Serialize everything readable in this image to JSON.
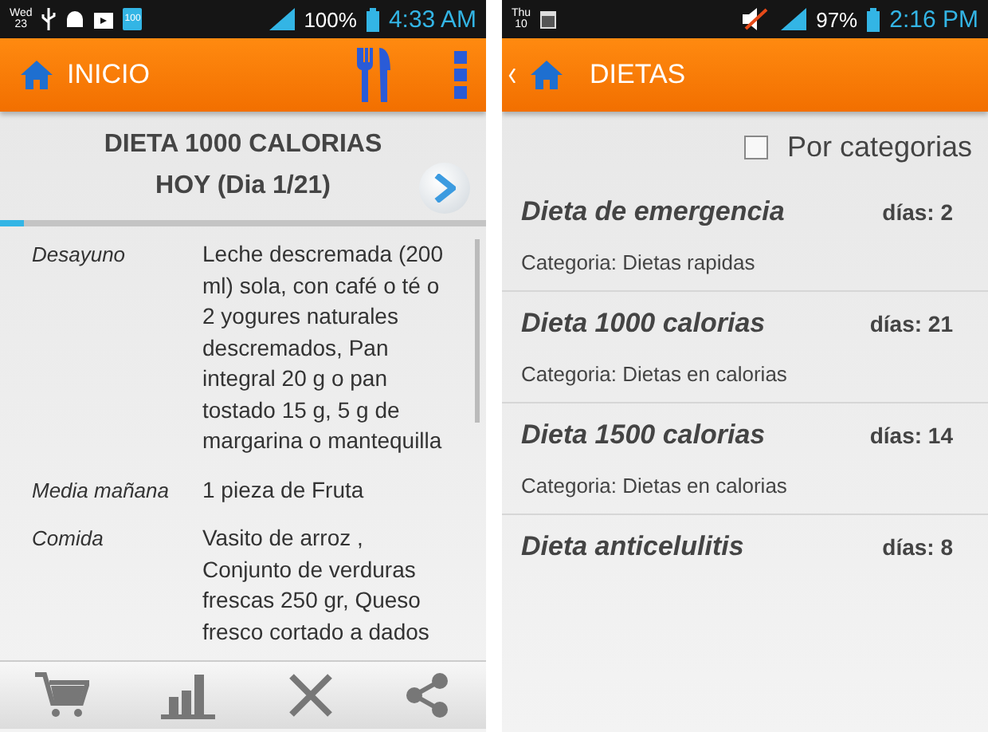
{
  "left_screen": {
    "status_bar": {
      "day_name": "Wed",
      "day_number": "23",
      "notification_badge": "100",
      "battery_percent": "100%",
      "time": "4:33 AM"
    },
    "action_bar": {
      "title": "INICIO"
    },
    "diet_title": "DIETA 1000 CALORIAS",
    "day_label": "HOY (Dia 1/21)",
    "progress": {
      "level": 0.05
    },
    "meals": [
      {
        "name": "Desayuno",
        "description": "Leche descremada (200 ml) sola, con café o té o 2 yogures naturales descremados, Pan integral 20 g o pan tostado 15 g, 5 g de margarina o mantequilla"
      },
      {
        "name": "Media mañana",
        "description": "1 pieza de Fruta"
      },
      {
        "name": "Comida",
        "description": "Vasito de arroz , Conjunto de verduras frescas 250 gr, Queso fresco cortado a dados"
      }
    ]
  },
  "right_screen": {
    "status_bar": {
      "day_name": "Thu",
      "day_number": "10",
      "battery_percent": "97%",
      "time": "2:16 PM"
    },
    "action_bar": {
      "title": "DIETAS"
    },
    "filter": {
      "label": "Por categorias",
      "checked": false
    },
    "diets": [
      {
        "name": "Dieta de emergencia",
        "days": "días: 2",
        "category": "Categoria: Dietas rapidas"
      },
      {
        "name": "Dieta 1000 calorias",
        "days": "días: 21",
        "category": "Categoria: Dietas en calorias"
      },
      {
        "name": "Dieta 1500 calorias",
        "days": "días: 14",
        "category": "Categoria: Dietas en calorias"
      },
      {
        "name": "Dieta anticelulitis",
        "days": "días: 8"
      }
    ]
  }
}
